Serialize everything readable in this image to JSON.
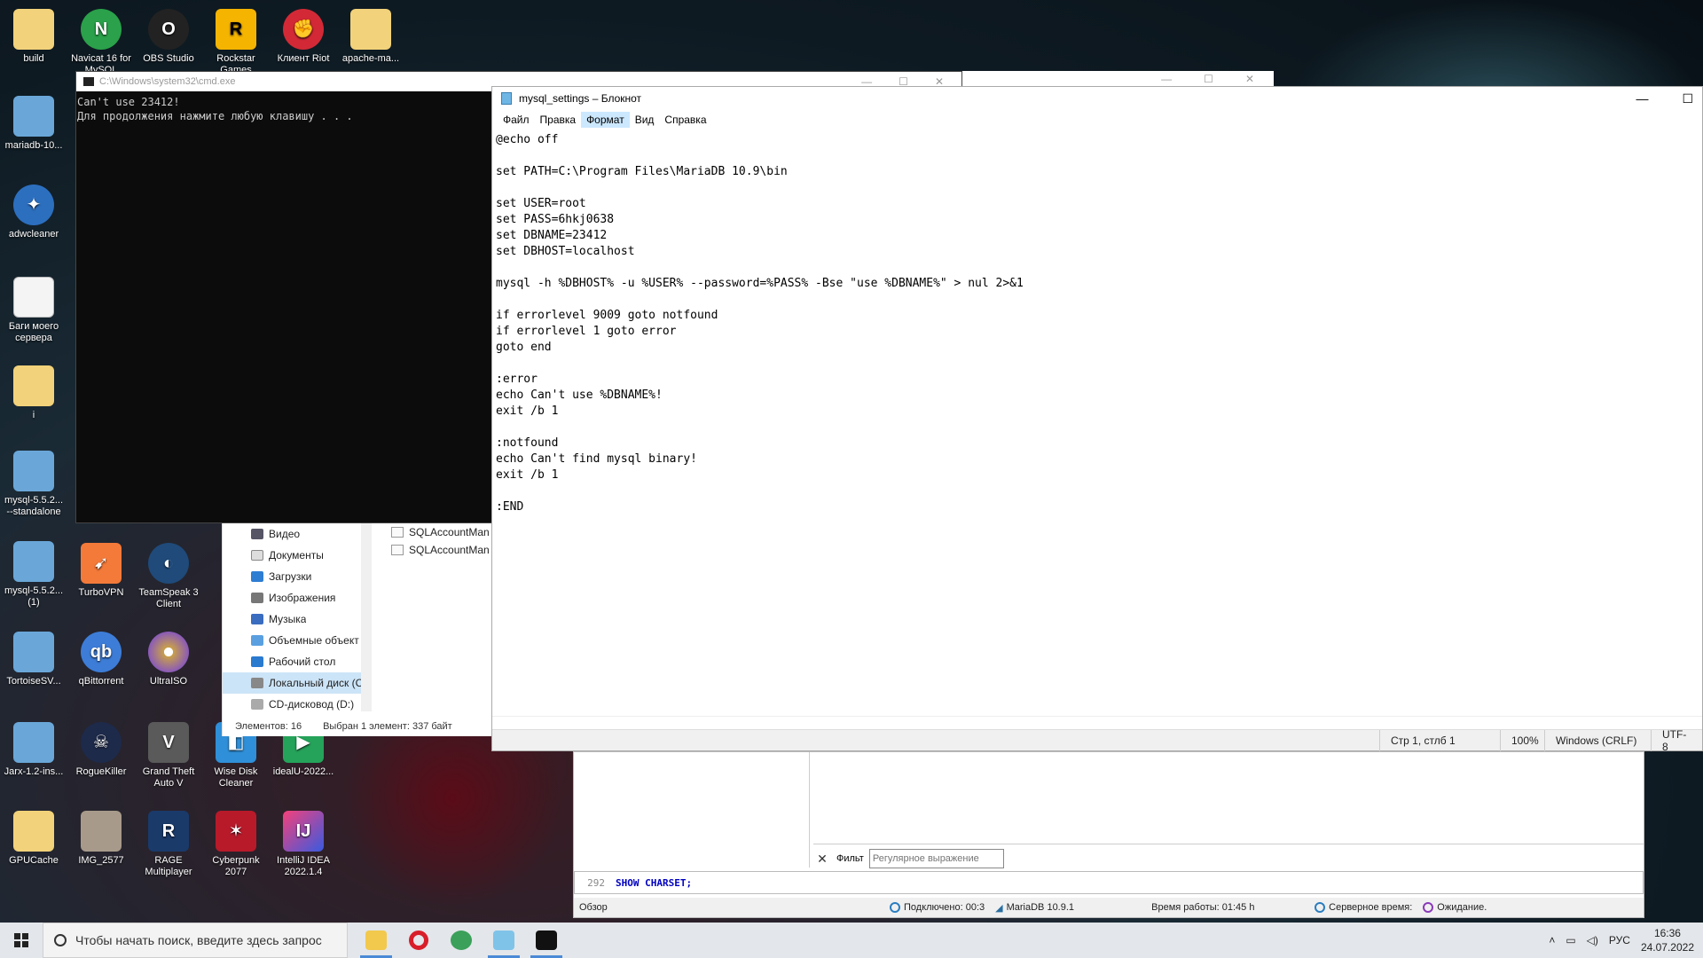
{
  "desktop": {
    "icons": [
      {
        "label": "build"
      },
      {
        "label": "Navicat 16 for MySQL"
      },
      {
        "label": "OBS Studio"
      },
      {
        "label": "Rockstar Games"
      },
      {
        "label": "Клиент Riot"
      },
      {
        "label": "apache-ma..."
      },
      {
        "label": "mariadb-10..."
      },
      {
        "label": "adwcleaner"
      },
      {
        "label": "Баги моего сервера"
      },
      {
        "label": "i"
      },
      {
        "label": "mysql-5.5.2... --standalone"
      },
      {
        "label": "mysql-5.5.2... (1)"
      },
      {
        "label": "TurboVPN"
      },
      {
        "label": "TeamSpeak 3 Client"
      },
      {
        "label": "TortoiseSV..."
      },
      {
        "label": "qBittorrent"
      },
      {
        "label": "UltraISO"
      },
      {
        "label": "Jarx-1.2-ins..."
      },
      {
        "label": "RogueKiller"
      },
      {
        "label": "Grand Theft Auto V"
      },
      {
        "label": "Wise Disk Cleaner"
      },
      {
        "label": "idealU-2022..."
      },
      {
        "label": "GPUCache"
      },
      {
        "label": "IMG_2577"
      },
      {
        "label": "RAGE Multiplayer"
      },
      {
        "label": "Cyberpunk 2077"
      },
      {
        "label": "IntelliJ IDEA 2022.1.4"
      }
    ]
  },
  "cmd": {
    "title": "C:\\Windows\\system32\\cmd.exe",
    "output": "Can't use 23412!\nДля продолжения нажмите любую клавишу . . ."
  },
  "explorer": {
    "tree": [
      "Видео",
      "Документы",
      "Загрузки",
      "Изображения",
      "Музыка",
      "Объемные объект",
      "Рабочий стол",
      "Локальный диск (C",
      "CD-дисковод (D:)"
    ],
    "files": [
      "SQLAccountMan",
      "SQLAccountMan"
    ],
    "status_count": "Элементов: 16",
    "status_selected": "Выбран 1 элемент: 337 байт"
  },
  "notepad": {
    "title": "mysql_settings – Блокнот",
    "menu": [
      "Файл",
      "Правка",
      "Формат",
      "Вид",
      "Справка"
    ],
    "content": "@echo off\n\nset PATH=C:\\Program Files\\MariaDB 10.9\\bin\n\nset USER=root\nset PASS=6hkj0638\nset DBNAME=23412\nset DBHOST=localhost\n\nmysql -h %DBHOST% -u %USER% --password=%PASS% -Bse \"use %DBNAME%\" > nul 2>&1\n\nif errorlevel 9009 goto notfound\nif errorlevel 1 goto error\ngoto end\n\n:error\necho Can't use %DBNAME%!\nexit /b 1\n\n:notfound\necho Can't find mysql binary!\nexit /b 1\n\n:END",
    "status": {
      "position": "Стр 1, стлб 1",
      "zoom": "100%",
      "line_endings": "Windows (CRLF)",
      "encoding": "UTF-8"
    }
  },
  "heidi": {
    "filter_label": "Фильт",
    "filter_placeholder": "Регулярное выражение",
    "line_number": "292",
    "sql": "SHOW CHARSET;",
    "status": {
      "overview": "Обзор",
      "connected": "Подключено: 00:3",
      "server": "MariaDB 10.9.1",
      "uptime": "Время работы: 01:45 h",
      "server_time": "Серверное время:",
      "waiting": "Ожидание."
    }
  },
  "taskbar": {
    "search_placeholder": "Чтобы начать поиск, введите здесь запрос",
    "lang": "РУС",
    "time": "16:36",
    "date": "24.07.2022"
  }
}
